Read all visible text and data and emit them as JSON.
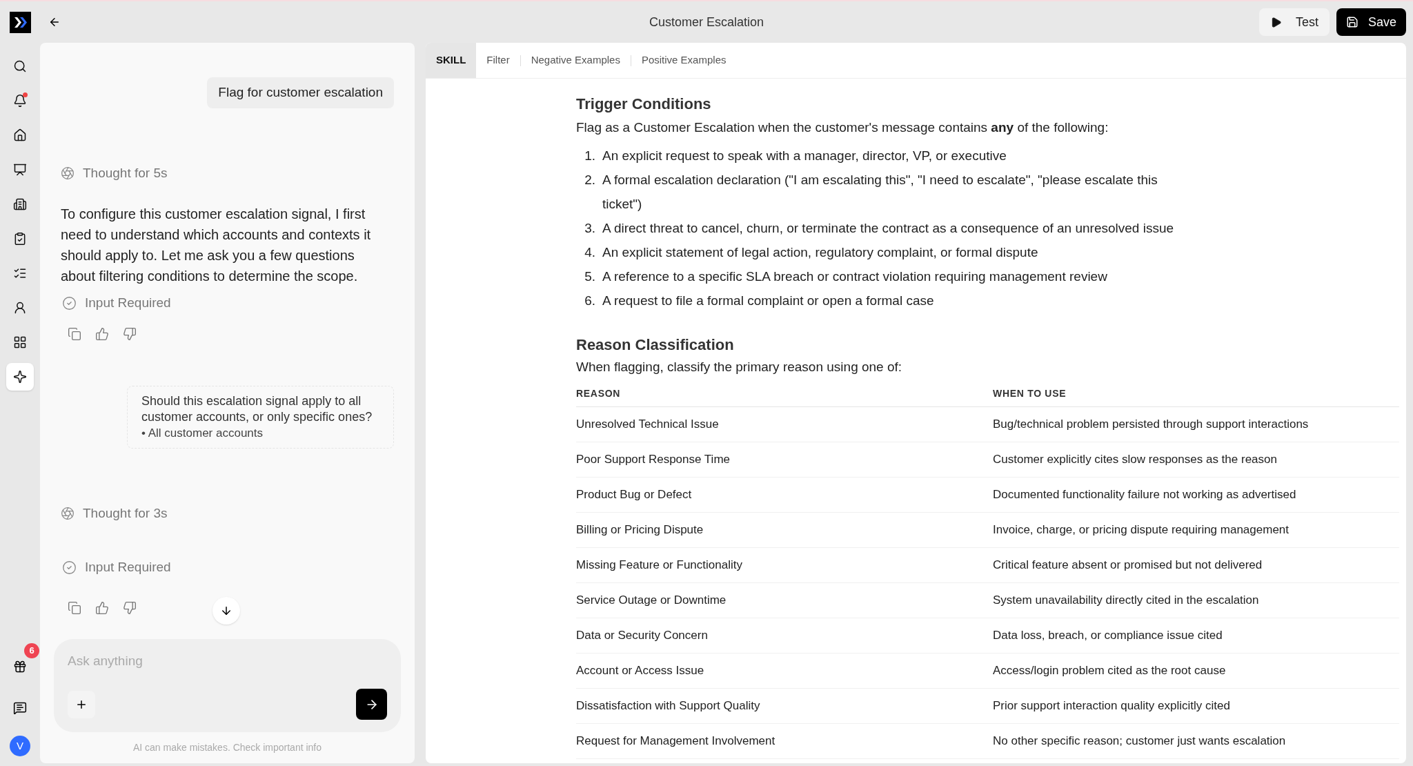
{
  "header": {
    "title": "Customer Escalation",
    "buttons": [
      {
        "kind": "test",
        "label": "Test"
      },
      {
        "kind": "save",
        "label": "Save"
      }
    ]
  },
  "sidebar": {
    "items": [
      {
        "selected": false,
        "alert": false
      },
      {
        "selected": false,
        "alert": true
      },
      {
        "selected": false,
        "alert": false
      },
      {
        "selected": false,
        "alert": false
      },
      {
        "selected": false,
        "alert": false
      },
      {
        "selected": false,
        "alert": false
      },
      {
        "selected": false,
        "alert": false
      },
      {
        "selected": false,
        "alert": false
      },
      {
        "selected": false,
        "alert": false
      },
      {
        "selected": true,
        "alert": false
      }
    ],
    "gift_badge": "6",
    "avatar": "V"
  },
  "chat": {
    "messages": [
      {
        "kind": "user",
        "text": "Flag for customer escalation"
      },
      {
        "kind": "thought",
        "text": "Thought for 5s"
      },
      {
        "kind": "assistant",
        "text": "To configure this customer escalation signal, I first need to understand which accounts and contexts it should apply to. Let me ask you a few questions about filtering conditions to determine the scope."
      },
      {
        "kind": "status",
        "text": "Input Required"
      },
      {
        "kind": "actions"
      },
      {
        "kind": "question",
        "text": "Should this escalation signal apply to all customer accounts, or only specific ones?",
        "answer": "All customer accounts",
        "bullet": "•"
      },
      {
        "kind": "thought",
        "text": "Thought for 3s"
      },
      {
        "kind": "status",
        "text": "Input Required"
      },
      {
        "kind": "actions"
      }
    ],
    "input": {
      "placeholder": "Ask anything"
    },
    "disclaimer": "AI can make mistakes. Check important info"
  },
  "tabs": [
    {
      "label": "SKILL",
      "selected": true
    },
    {
      "label": "Filter",
      "selected": false
    },
    {
      "label": "Negative Examples",
      "selected": false
    },
    {
      "label": "Positive Examples",
      "selected": false
    }
  ],
  "skill": {
    "trigger": {
      "heading": "Trigger Conditions",
      "intro": "Flag as a Customer Escalation when the customer's message contains **any** of the following:",
      "items": [
        {
          "number": "1.",
          "text": "An explicit request to speak with a manager, director, VP, or executive"
        },
        {
          "number": "2.",
          "text": "A formal escalation declaration (\"I am escalating this\", \"I need to escalate\", \"please escalate this ticket\")"
        },
        {
          "number": "3.",
          "text": "A direct threat to cancel, churn, or terminate the contract as a consequence of an unresolved issue"
        },
        {
          "number": "4.",
          "text": "An explicit statement of legal action, regulatory complaint, or formal dispute"
        },
        {
          "number": "5.",
          "text": "A reference to a specific SLA breach or contract violation requiring management review"
        },
        {
          "number": "6.",
          "text": "A request to file a formal complaint or open a formal case"
        }
      ]
    },
    "reasons": {
      "heading": "Reason Classification",
      "intro": "When flagging, classify the primary reason using one of:",
      "table": {
        "columns": [
          "REASON",
          "WHEN TO USE"
        ],
        "rows": [
          [
            "Unresolved Technical Issue",
            "Bug/technical problem persisted through support interactions"
          ],
          [
            "Poor Support Response Time",
            "Customer explicitly cites slow responses as the reason"
          ],
          [
            "Product Bug or Defect",
            "Documented functionality failure not working as advertised"
          ],
          [
            "Billing or Pricing Dispute",
            "Invoice, charge, or pricing dispute requiring management"
          ],
          [
            "Missing Feature or Functionality",
            "Critical feature absent or promised but not delivered"
          ],
          [
            "Service Outage or Downtime",
            "System unavailability directly cited in the escalation"
          ],
          [
            "Data or Security Concern",
            "Data loss, breach, or compliance issue cited"
          ],
          [
            "Account or Access Issue",
            "Access/login problem cited as the root cause"
          ],
          [
            "Dissatisfaction with Support Quality",
            "Prior support interaction quality explicitly cited"
          ],
          [
            "Request for Management Involvement",
            "No other specific reason; customer just wants escalation"
          ]
        ]
      }
    }
  }
}
